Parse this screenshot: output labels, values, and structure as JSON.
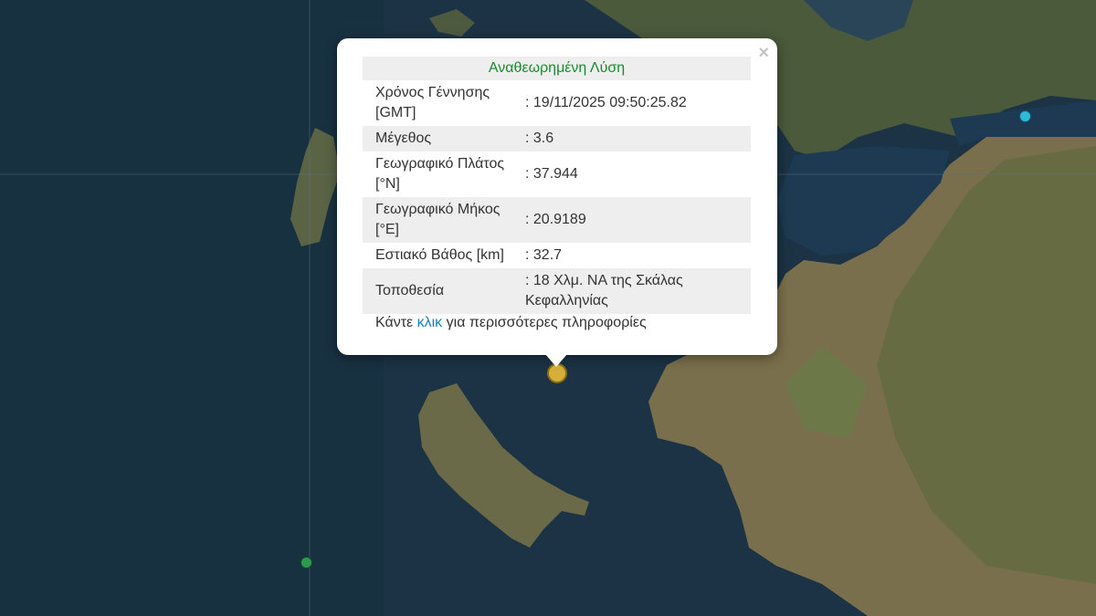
{
  "popup": {
    "close_label": "×",
    "header": "Αναθεωρημένη Λύση",
    "rows": [
      {
        "label": "Χρόνος Γέννησης [GMT]",
        "value": ": 19/11/2025 09:50:25.82"
      },
      {
        "label": "Μέγεθος",
        "value": ": 3.6"
      },
      {
        "label": "Γεωγραφικό Πλάτος [°N]",
        "value": ": 37.944"
      },
      {
        "label": "Γεωγραφικό Μήκος [°E]",
        "value": ": 20.9189"
      },
      {
        "label": "Εστιακό Βάθος [km]",
        "value": ": 32.7"
      },
      {
        "label": "Τοποθεσία",
        "value": ": 18 Χλμ. ΝΑ της Σκάλας Κεφαλληνίας"
      }
    ],
    "more_prefix": "Κάντε ",
    "more_link": "κλικ",
    "more_suffix": " για περισσότερες πληροφορίες"
  },
  "markers": {
    "selected_color": "#d4b03a",
    "blue_color": "#2fb8d8",
    "green_color": "#2e9a4e"
  }
}
